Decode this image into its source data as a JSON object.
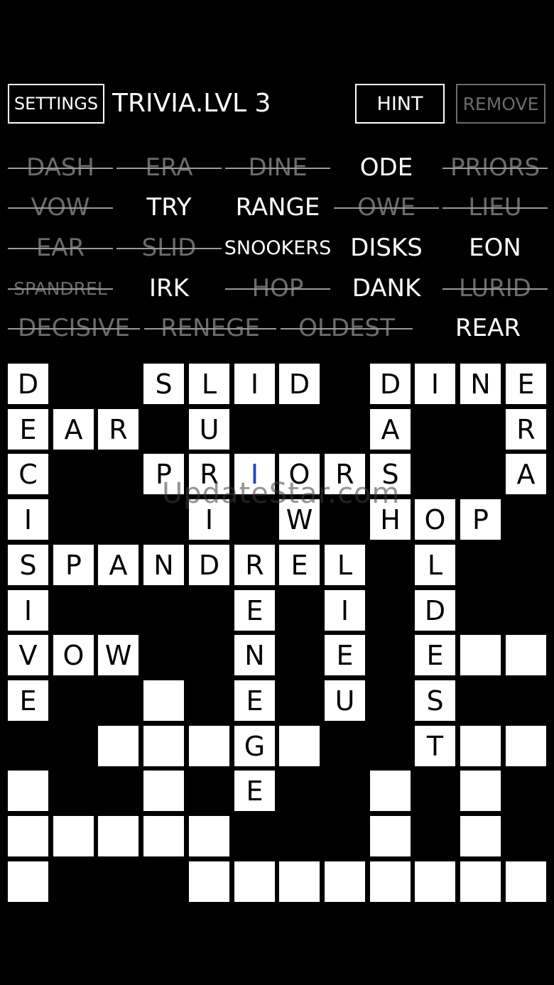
{
  "toolbar": {
    "settings_label": "SETTINGS",
    "title": "TRIVIA.LVL 3",
    "hint_label": "HINT",
    "remove_label": "REMOVE"
  },
  "word_rows": [
    [
      {
        "text": "DASH",
        "found": true
      },
      {
        "text": "ERA",
        "found": true
      },
      {
        "text": "DINE",
        "found": true
      },
      {
        "text": "ODE",
        "found": false
      },
      {
        "text": "PRIORS",
        "found": true
      }
    ],
    [
      {
        "text": "VOW",
        "found": true
      },
      {
        "text": "TRY",
        "found": false
      },
      {
        "text": "RANGE",
        "found": false
      },
      {
        "text": "OWE",
        "found": true
      },
      {
        "text": "LIEU",
        "found": true
      }
    ],
    [
      {
        "text": "EAR",
        "found": true
      },
      {
        "text": "SLID",
        "found": true
      },
      {
        "text": "SNOOKERS",
        "found": false
      },
      {
        "text": "DISKS",
        "found": false
      },
      {
        "text": "EON",
        "found": false
      }
    ],
    [
      {
        "text": "SPANDREL",
        "found": true
      },
      {
        "text": "IRK",
        "found": false
      },
      {
        "text": "HOP",
        "found": true
      },
      {
        "text": "DANK",
        "found": false
      },
      {
        "text": "LURID",
        "found": true
      }
    ],
    [
      {
        "text": "DECISIVE",
        "found": true
      },
      {
        "text": "RENEGE",
        "found": true
      },
      {
        "text": "OLDEST",
        "found": true
      },
      {
        "text": "REAR",
        "found": false
      }
    ]
  ],
  "grid": {
    "size": 12,
    "highlight_color": "#1b3ed8",
    "rows": [
      "D..SLID.DINE",
      "EAR.U...A..R",
      "C..PRIORS..A",
      "I...I.W.HOP.",
      "SPANDREL.L..",
      "I....E.I.D..",
      "VOW..N.E.E##",
      "E..#.E.U.S..",
      "..###G#..T##",
      "#..#.E..#.#.",
      "#####...#.#.",
      "#...########"
    ],
    "highlight": [
      [
        2,
        5
      ]
    ]
  },
  "watermark": "UpdateStar.com"
}
